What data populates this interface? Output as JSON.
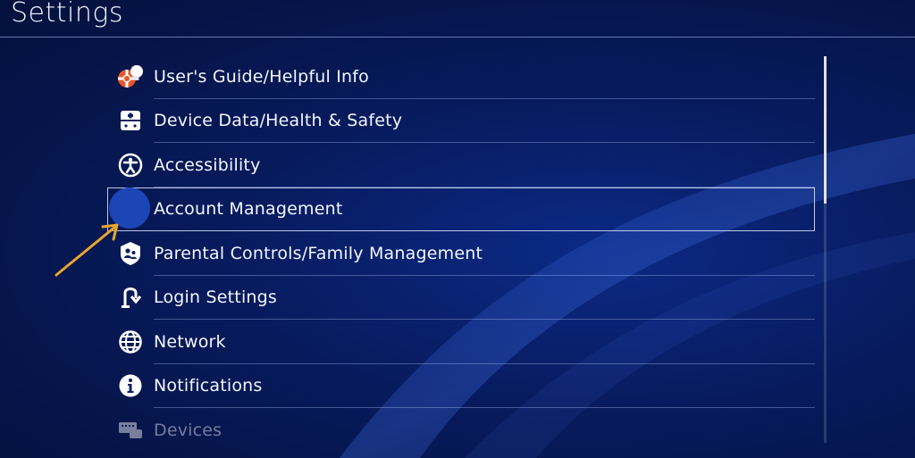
{
  "header": {
    "title": "Settings"
  },
  "menu": [
    {
      "label": "User's Guide/Helpful Info",
      "icon": "lifebuoy-bulb-icon"
    },
    {
      "label": "Device Data/Health & Safety",
      "icon": "device-health-icon"
    },
    {
      "label": "Accessibility",
      "icon": "accessibility-icon"
    },
    {
      "label": "Account Management",
      "icon": "account-icon",
      "selected": true
    },
    {
      "label": "Parental Controls/Family Management",
      "icon": "parental-controls-icon"
    },
    {
      "label": "Login Settings",
      "icon": "login-settings-icon"
    },
    {
      "label": "Network",
      "icon": "globe-icon"
    },
    {
      "label": "Notifications",
      "icon": "info-icon"
    },
    {
      "label": "Devices",
      "icon": "keyboard-icon"
    }
  ],
  "colors": {
    "accent_arrow": "#e8a62b",
    "selection_fill": "#1c45b5"
  }
}
